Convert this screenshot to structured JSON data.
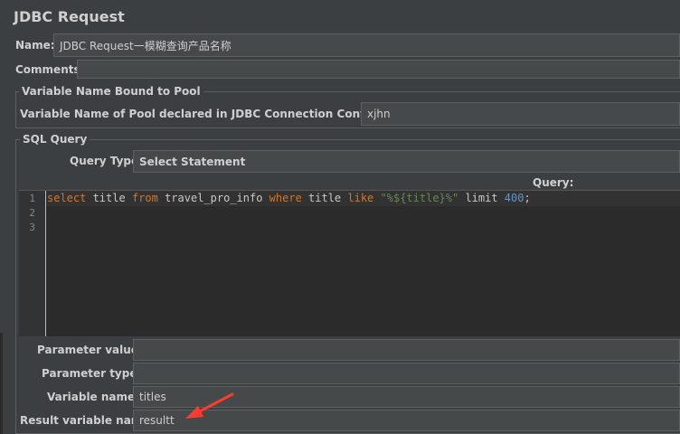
{
  "header": {
    "title": "JDBC Request"
  },
  "name_field": {
    "label": "Name:",
    "value": "JDBC Request一模糊查询产品名称"
  },
  "comments_field": {
    "label": "Comments:",
    "value": ""
  },
  "pool_group": {
    "title": "Variable Name Bound to Pool",
    "pool_label": "Variable Name of Pool declared in JDBC Connection Configuration:",
    "pool_value": "xjhn"
  },
  "sql_group": {
    "title": "SQL Query",
    "query_type_label": "Query Type:",
    "query_type_value": "Select Statement",
    "query_label": "Query:",
    "line_numbers": [
      "1",
      "2",
      "3"
    ],
    "code": {
      "t1": "select",
      "t2": " title ",
      "t3": "from",
      "t4": " travel_pro_info ",
      "t5": "where",
      "t6": " title ",
      "t7": "like",
      "t8": " ",
      "t9": "\"%${title}%\"",
      "t10": " limit ",
      "t11": "400",
      "t12": ";"
    }
  },
  "params": {
    "param_values_label": "Parameter values:",
    "param_values": "",
    "param_types_label": "Parameter types:",
    "param_types": "",
    "variable_names_label": "Variable names:",
    "variable_names": "titles",
    "result_var_label": "Result variable name:",
    "result_var": "resultt"
  },
  "colors": {
    "background": "#3c3f41",
    "editor_bg": "#2b2b2b",
    "keyword": "#cc7832",
    "string": "#6a8759",
    "number": "#6897bb",
    "annotation_arrow": "#ff3b30"
  }
}
